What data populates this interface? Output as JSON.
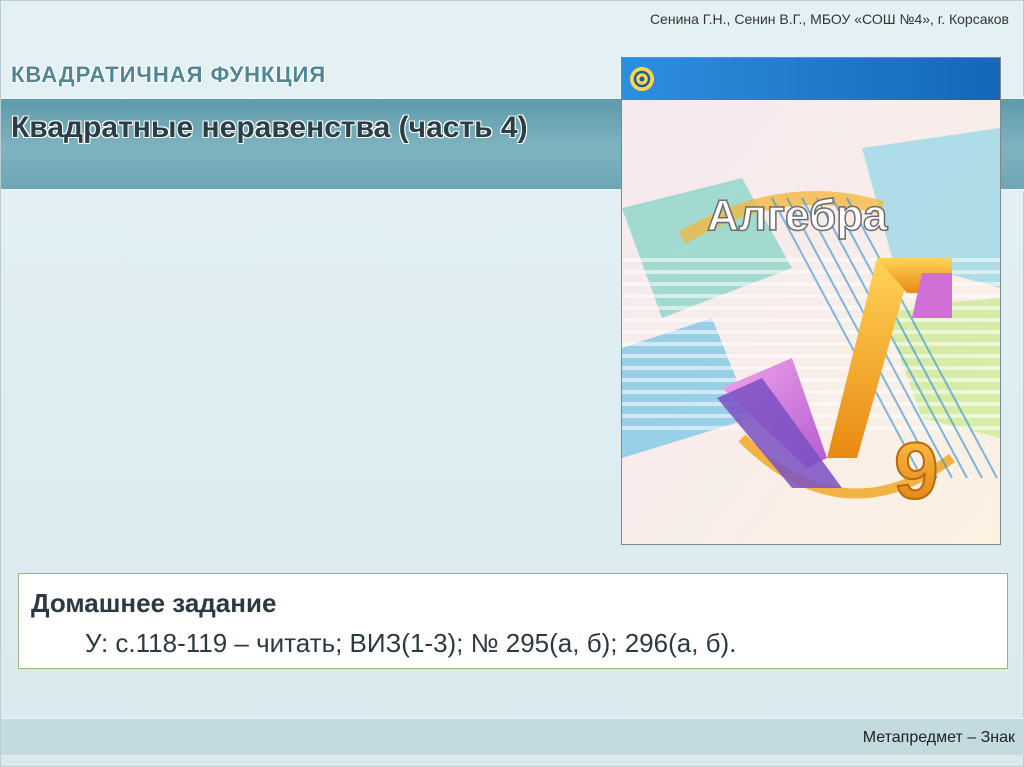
{
  "header": {
    "author_line": "Сенина Г.Н., Сенин В.Г., МБОУ «СОШ №4», г. Корсаков"
  },
  "slide": {
    "topic": "КВАДРАТИЧНАЯ ФУНКЦИЯ",
    "title": "Квадратные неравенства (часть 4)"
  },
  "book_cover": {
    "title": "Алгебра",
    "grade": "9",
    "colors": {
      "blue_band": "#1d7fd0",
      "orange": "#f0a21c",
      "purple": "#8a5bc7",
      "pink": "#e07ad8",
      "cyan": "#2fb6d9"
    }
  },
  "homework": {
    "heading": "Домашнее задание",
    "text": "У: с.118-119 – читать; ВИЗ(1-3); № 295(а, б);  296(а, б)."
  },
  "footer": {
    "label": "Метапредмет – Знак"
  }
}
